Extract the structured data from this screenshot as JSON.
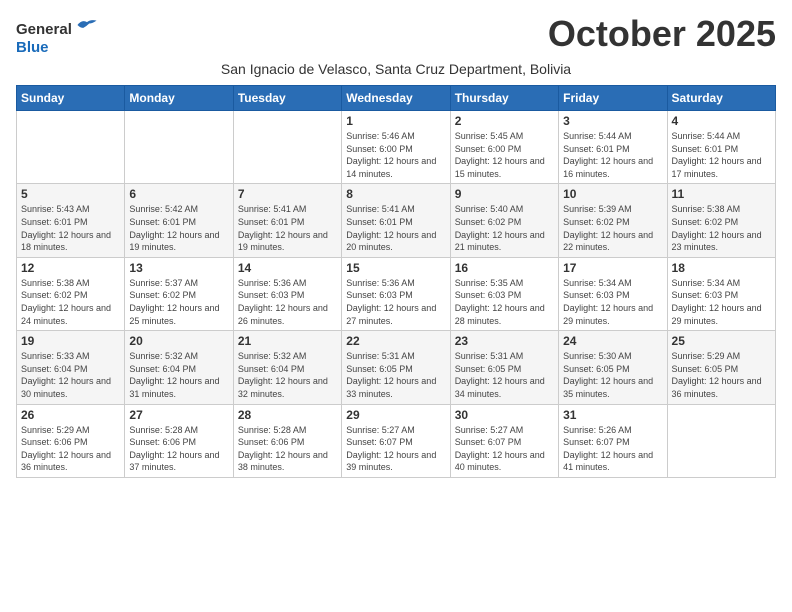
{
  "header": {
    "logo_general": "General",
    "logo_blue": "Blue",
    "month_title": "October 2025",
    "subtitle": "San Ignacio de Velasco, Santa Cruz Department, Bolivia"
  },
  "weekdays": [
    "Sunday",
    "Monday",
    "Tuesday",
    "Wednesday",
    "Thursday",
    "Friday",
    "Saturday"
  ],
  "weeks": [
    [
      {
        "day": "",
        "sunrise": "",
        "sunset": "",
        "daylight": ""
      },
      {
        "day": "",
        "sunrise": "",
        "sunset": "",
        "daylight": ""
      },
      {
        "day": "",
        "sunrise": "",
        "sunset": "",
        "daylight": ""
      },
      {
        "day": "1",
        "sunrise": "Sunrise: 5:46 AM",
        "sunset": "Sunset: 6:00 PM",
        "daylight": "Daylight: 12 hours and 14 minutes."
      },
      {
        "day": "2",
        "sunrise": "Sunrise: 5:45 AM",
        "sunset": "Sunset: 6:00 PM",
        "daylight": "Daylight: 12 hours and 15 minutes."
      },
      {
        "day": "3",
        "sunrise": "Sunrise: 5:44 AM",
        "sunset": "Sunset: 6:01 PM",
        "daylight": "Daylight: 12 hours and 16 minutes."
      },
      {
        "day": "4",
        "sunrise": "Sunrise: 5:44 AM",
        "sunset": "Sunset: 6:01 PM",
        "daylight": "Daylight: 12 hours and 17 minutes."
      }
    ],
    [
      {
        "day": "5",
        "sunrise": "Sunrise: 5:43 AM",
        "sunset": "Sunset: 6:01 PM",
        "daylight": "Daylight: 12 hours and 18 minutes."
      },
      {
        "day": "6",
        "sunrise": "Sunrise: 5:42 AM",
        "sunset": "Sunset: 6:01 PM",
        "daylight": "Daylight: 12 hours and 19 minutes."
      },
      {
        "day": "7",
        "sunrise": "Sunrise: 5:41 AM",
        "sunset": "Sunset: 6:01 PM",
        "daylight": "Daylight: 12 hours and 19 minutes."
      },
      {
        "day": "8",
        "sunrise": "Sunrise: 5:41 AM",
        "sunset": "Sunset: 6:01 PM",
        "daylight": "Daylight: 12 hours and 20 minutes."
      },
      {
        "day": "9",
        "sunrise": "Sunrise: 5:40 AM",
        "sunset": "Sunset: 6:02 PM",
        "daylight": "Daylight: 12 hours and 21 minutes."
      },
      {
        "day": "10",
        "sunrise": "Sunrise: 5:39 AM",
        "sunset": "Sunset: 6:02 PM",
        "daylight": "Daylight: 12 hours and 22 minutes."
      },
      {
        "day": "11",
        "sunrise": "Sunrise: 5:38 AM",
        "sunset": "Sunset: 6:02 PM",
        "daylight": "Daylight: 12 hours and 23 minutes."
      }
    ],
    [
      {
        "day": "12",
        "sunrise": "Sunrise: 5:38 AM",
        "sunset": "Sunset: 6:02 PM",
        "daylight": "Daylight: 12 hours and 24 minutes."
      },
      {
        "day": "13",
        "sunrise": "Sunrise: 5:37 AM",
        "sunset": "Sunset: 6:02 PM",
        "daylight": "Daylight: 12 hours and 25 minutes."
      },
      {
        "day": "14",
        "sunrise": "Sunrise: 5:36 AM",
        "sunset": "Sunset: 6:03 PM",
        "daylight": "Daylight: 12 hours and 26 minutes."
      },
      {
        "day": "15",
        "sunrise": "Sunrise: 5:36 AM",
        "sunset": "Sunset: 6:03 PM",
        "daylight": "Daylight: 12 hours and 27 minutes."
      },
      {
        "day": "16",
        "sunrise": "Sunrise: 5:35 AM",
        "sunset": "Sunset: 6:03 PM",
        "daylight": "Daylight: 12 hours and 28 minutes."
      },
      {
        "day": "17",
        "sunrise": "Sunrise: 5:34 AM",
        "sunset": "Sunset: 6:03 PM",
        "daylight": "Daylight: 12 hours and 29 minutes."
      },
      {
        "day": "18",
        "sunrise": "Sunrise: 5:34 AM",
        "sunset": "Sunset: 6:03 PM",
        "daylight": "Daylight: 12 hours and 29 minutes."
      }
    ],
    [
      {
        "day": "19",
        "sunrise": "Sunrise: 5:33 AM",
        "sunset": "Sunset: 6:04 PM",
        "daylight": "Daylight: 12 hours and 30 minutes."
      },
      {
        "day": "20",
        "sunrise": "Sunrise: 5:32 AM",
        "sunset": "Sunset: 6:04 PM",
        "daylight": "Daylight: 12 hours and 31 minutes."
      },
      {
        "day": "21",
        "sunrise": "Sunrise: 5:32 AM",
        "sunset": "Sunset: 6:04 PM",
        "daylight": "Daylight: 12 hours and 32 minutes."
      },
      {
        "day": "22",
        "sunrise": "Sunrise: 5:31 AM",
        "sunset": "Sunset: 6:05 PM",
        "daylight": "Daylight: 12 hours and 33 minutes."
      },
      {
        "day": "23",
        "sunrise": "Sunrise: 5:31 AM",
        "sunset": "Sunset: 6:05 PM",
        "daylight": "Daylight: 12 hours and 34 minutes."
      },
      {
        "day": "24",
        "sunrise": "Sunrise: 5:30 AM",
        "sunset": "Sunset: 6:05 PM",
        "daylight": "Daylight: 12 hours and 35 minutes."
      },
      {
        "day": "25",
        "sunrise": "Sunrise: 5:29 AM",
        "sunset": "Sunset: 6:05 PM",
        "daylight": "Daylight: 12 hours and 36 minutes."
      }
    ],
    [
      {
        "day": "26",
        "sunrise": "Sunrise: 5:29 AM",
        "sunset": "Sunset: 6:06 PM",
        "daylight": "Daylight: 12 hours and 36 minutes."
      },
      {
        "day": "27",
        "sunrise": "Sunrise: 5:28 AM",
        "sunset": "Sunset: 6:06 PM",
        "daylight": "Daylight: 12 hours and 37 minutes."
      },
      {
        "day": "28",
        "sunrise": "Sunrise: 5:28 AM",
        "sunset": "Sunset: 6:06 PM",
        "daylight": "Daylight: 12 hours and 38 minutes."
      },
      {
        "day": "29",
        "sunrise": "Sunrise: 5:27 AM",
        "sunset": "Sunset: 6:07 PM",
        "daylight": "Daylight: 12 hours and 39 minutes."
      },
      {
        "day": "30",
        "sunrise": "Sunrise: 5:27 AM",
        "sunset": "Sunset: 6:07 PM",
        "daylight": "Daylight: 12 hours and 40 minutes."
      },
      {
        "day": "31",
        "sunrise": "Sunrise: 5:26 AM",
        "sunset": "Sunset: 6:07 PM",
        "daylight": "Daylight: 12 hours and 41 minutes."
      },
      {
        "day": "",
        "sunrise": "",
        "sunset": "",
        "daylight": ""
      }
    ]
  ]
}
